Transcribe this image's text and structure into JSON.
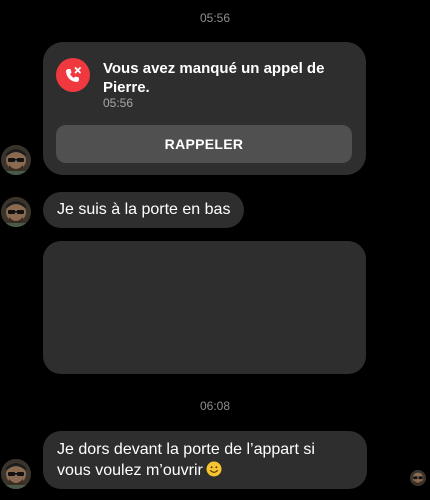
{
  "conversation": {
    "timestamp_1": "05:56",
    "missed_call": {
      "title": "Vous avez manqué un appel de Pierre.",
      "time": "05:56",
      "callback_label": "RAPPELER",
      "icon": "missed-call-icon"
    },
    "message_1": "Je suis à la porte en bas",
    "timestamp_2": "06:08",
    "message_2": "Je dors devant la porte de l’appart si vous voulez m’ouvrir",
    "message_2_emoji": "smiling-face-emoji"
  },
  "colors": {
    "background": "#000000",
    "bubble": "#2e2e2e",
    "button": "#505050",
    "missed_call_red": "#f0393f",
    "timestamp_text": "#8e8e8e"
  }
}
